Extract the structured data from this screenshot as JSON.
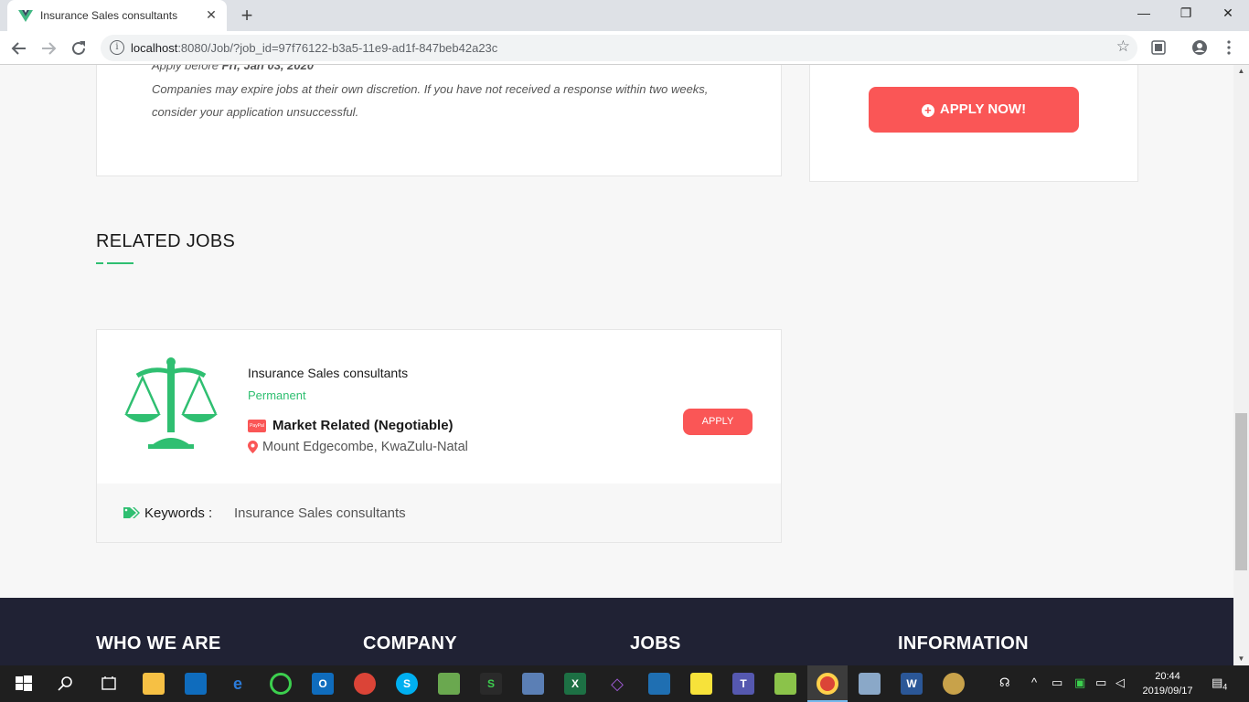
{
  "browser": {
    "tab_title": "Insurance Sales consultants",
    "close_glyph": "✕",
    "new_tab_glyph": "+",
    "url_host": "localhost",
    "url_rest": ":8080/Job/?job_id=97f76122-b3a5-11e9-ad1f-847beb42a23c",
    "star_glyph": "☆",
    "window": {
      "minimize": "—",
      "restore": "❐",
      "close": "✕"
    }
  },
  "job_detail": {
    "apply_before_label": "Apply before",
    "apply_before_date": "Fri, Jan 03, 2020",
    "notice": "Companies may expire jobs at their own discretion. If you have not received a response within two weeks, consider your application unsuccessful.",
    "apply_now_label": "APPLY NOW!",
    "apply_now_icon": "+"
  },
  "related": {
    "heading": "RELATED JOBS",
    "jobs": [
      {
        "title": "Insurance Sales consultants",
        "type": "Permanent",
        "salary": "Market Related (Negotiable)",
        "salary_icon_text": "PayPal",
        "location": "Mount Edgecombe, KwaZulu-Natal",
        "apply_label": "APPLY",
        "keywords_label": "Keywords :",
        "keywords": "Insurance Sales consultants"
      }
    ]
  },
  "footer": {
    "headings": [
      "WHO WE ARE",
      "COMPANY",
      "JOBS",
      "INFORMATION"
    ]
  },
  "taskbar": {
    "time": "20:44",
    "date": "2019/09/17",
    "notification_count": "4"
  },
  "colors": {
    "accent_green": "#2fbf71",
    "apply_red": "#fa5656",
    "footer_bg": "#202234"
  }
}
